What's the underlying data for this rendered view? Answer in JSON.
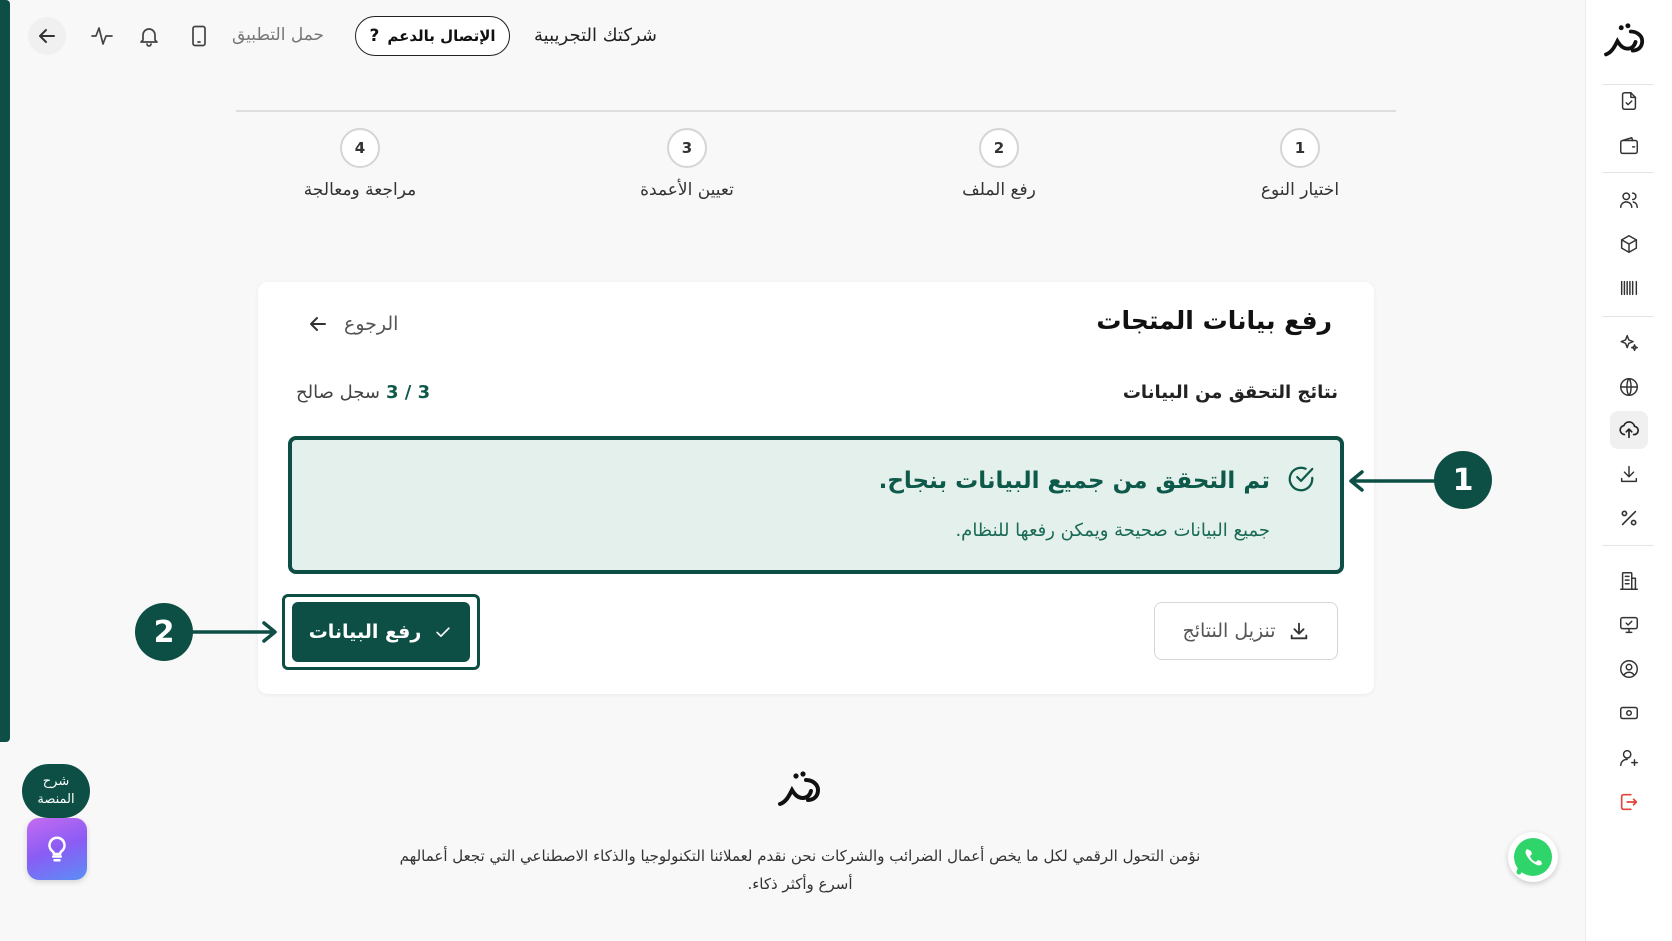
{
  "topbar": {
    "company": "شركتك التجريبية",
    "support_label": "الإتصال بالدعم",
    "download_app": "حمل التطبيق"
  },
  "steps": [
    {
      "num": "1",
      "label": "اختيار النوع"
    },
    {
      "num": "2",
      "label": "رفع الملف"
    },
    {
      "num": "3",
      "label": "تعيين الأعمدة"
    },
    {
      "num": "4",
      "label": "مراجعة ومعالجة"
    }
  ],
  "card": {
    "title": "رفع بيانات المتجات",
    "back_label": "الرجوع",
    "results_title": "نتائج التحقق من البيانات",
    "valid_count": "3 / 3",
    "valid_suffix": "سجل صالح",
    "success_title": "تم التحقق من جميع البيانات بنجاح.",
    "success_message": "جميع البيانات صحيحة ويمكن رفعها للنظام.",
    "download_label": "تنزيل النتائج",
    "upload_label": "رفع البيانات"
  },
  "callouts": {
    "one": "1",
    "two": "2"
  },
  "footer": {
    "line1": "نؤمن التحول الرقمي لكل ما يخص أعمال الضرائب والشركات نحن نقدم لعملائنا التكنولوجيا والذكاء الاصطناعي التي تجعل أعمالهم",
    "line2": "أسرع وأكثر ذكاء."
  },
  "helper": {
    "explain_line1": "شرح",
    "explain_line2": "المنصة"
  },
  "colors": {
    "brand": "#0d4f45",
    "success_bg": "#e4f0ec",
    "success_text": "#0d5a4a"
  },
  "icons": [
    "arrow-left-icon",
    "pulse-icon",
    "bell-icon",
    "phone-icon",
    "question-icon",
    "check-icon",
    "download-icon",
    "bulb-icon",
    "whatsapp-icon"
  ]
}
